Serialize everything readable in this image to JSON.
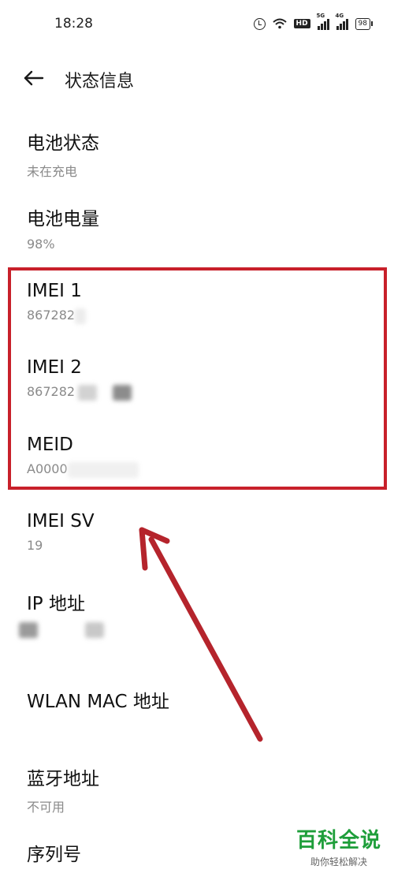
{
  "status_bar": {
    "time": "18:28",
    "hd_badge": "HD",
    "sim1_label": "5G",
    "sim2_label": "4G",
    "battery": "98"
  },
  "header": {
    "back_icon": "arrow-left-icon",
    "title": "状态信息"
  },
  "items": [
    {
      "title": "电池状态",
      "value": "未在充电"
    },
    {
      "title": "电池电量",
      "value": "98%"
    },
    {
      "title": "IMEI 1",
      "value": "867282"
    },
    {
      "title": "IMEI 2",
      "value": "867282"
    },
    {
      "title": "MEID",
      "value": "A0000"
    },
    {
      "title": "IMEI SV",
      "value": "19"
    },
    {
      "title": "IP 地址",
      "value": ""
    },
    {
      "title": "WLAN MAC 地址",
      "value": ""
    },
    {
      "title": "蓝牙地址",
      "value": "不可用"
    },
    {
      "title": "序列号",
      "value": ""
    }
  ],
  "annotation": {
    "color": "#c8202a"
  },
  "watermark": {
    "main": "百科全说",
    "sub": "助你轻松解决",
    "color": "#1e9e3a"
  }
}
